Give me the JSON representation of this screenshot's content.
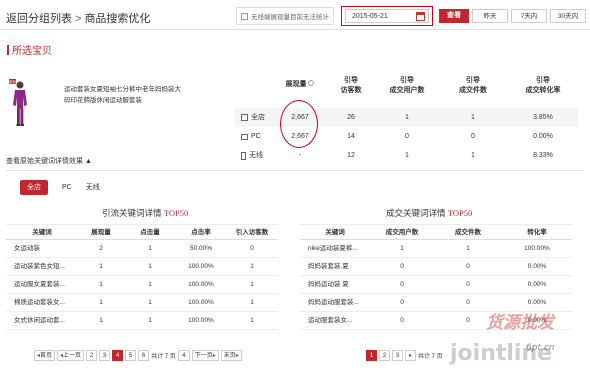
{
  "breadcrumb": {
    "back": "返回分组列表",
    "sep": ">",
    "current": "商品搜索优化"
  },
  "topbar": {
    "notice": "无线端展现量目前无法统计",
    "date": "2015-05-21",
    "query_label": "查看",
    "ranges": [
      "昨天",
      "7天内",
      "30天内"
    ]
  },
  "section": {
    "title": "所选宝贝"
  },
  "product": {
    "badge": "新品",
    "title": "运动套装女夏短袖七分裤中老年妈妈装大码印花韩版休闲运动服套装"
  },
  "metrics": {
    "headers": [
      {
        "l1": "展现量",
        "l2": ""
      },
      {
        "l1": "引导",
        "l2": "访客数"
      },
      {
        "l1": "引导",
        "l2": "成交用户数"
      },
      {
        "l1": "引导",
        "l2": "成交件数"
      },
      {
        "l1": "引导",
        "l2": "成交转化率"
      }
    ],
    "rows": [
      {
        "label": "全店",
        "icon": "store-icon",
        "vals": [
          "2,667",
          "26",
          "1",
          "1",
          "3.85%"
        ]
      },
      {
        "label": "PC",
        "icon": "monitor-icon",
        "vals": [
          "2,667",
          "14",
          "0",
          "0",
          "0.00%"
        ]
      },
      {
        "label": "无线",
        "icon": "mobile-icon",
        "vals": [
          "-",
          "12",
          "1",
          "1",
          "8.33%"
        ]
      }
    ]
  },
  "toggle_label": "查看原始关键词详情效果 ▲",
  "tabs": [
    "全店",
    "PC",
    "无线"
  ],
  "left_table": {
    "title_text": "引流关键词详情 ",
    "title_top": "TOP50",
    "headers": [
      "关键词",
      "展现量",
      "点击量",
      "点击率",
      "引入访客数"
    ],
    "rows": [
      [
        "女运动装",
        "2",
        "1",
        "50.00%",
        "0"
      ],
      [
        "运动装紫色女短...",
        "1",
        "1",
        "100.00%",
        "1"
      ],
      [
        "运动服女夏套装...",
        "1",
        "1",
        "100.00%",
        "1"
      ],
      [
        "棉质运动套装女...",
        "1",
        "1",
        "100.00%",
        "1"
      ],
      [
        "女式休闲运动套...",
        "1",
        "1",
        "100.00%",
        "1"
      ]
    ]
  },
  "right_table": {
    "title_text": "成交关键词详情 ",
    "title_top": "TOP50",
    "headers": [
      "关键词",
      "成交用户数",
      "成交件数",
      "转化率"
    ],
    "rows": [
      [
        "nike运动装夏裤...",
        "1",
        "1",
        "100.00%"
      ],
      [
        "妈妈装套装.夏",
        "0",
        "0",
        "0.00%"
      ],
      [
        "妈妈运动装 夏",
        "0",
        "0",
        "0.00%"
      ],
      [
        "妈妈运动服套装...",
        "0",
        "0",
        "0.00%"
      ],
      [
        "运动服套装女...",
        "0",
        "0",
        "0.00%"
      ]
    ]
  },
  "left_pager": {
    "first": "首页",
    "prev": "上一页",
    "pages": [
      "2",
      "3",
      "4",
      "5",
      "6"
    ],
    "current": "4",
    "total": "共计 7 页",
    "input": "4",
    "next": "下一页",
    "last": "末页"
  },
  "right_pager": {
    "pages": [
      "1",
      "2",
      "3"
    ],
    "current": "1",
    "total": "共计 7 页"
  },
  "watermark": {
    "line1": "货源批发",
    "line2": "jointline",
    "domain": "6pt.cn"
  },
  "colors": {
    "accent": "#c1272d",
    "highlight": "#d0021b"
  }
}
